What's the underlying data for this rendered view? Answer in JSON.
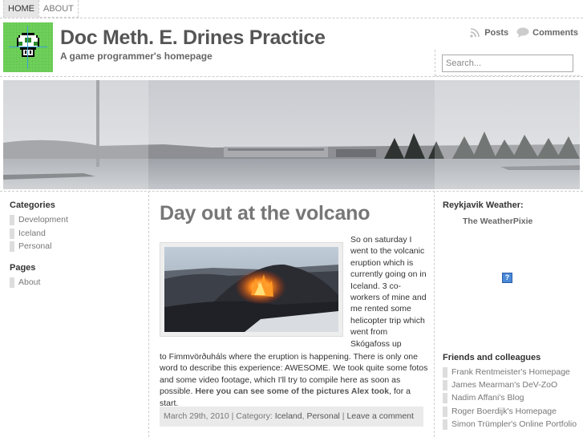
{
  "nav": {
    "items": [
      {
        "label": "HOME",
        "active": true
      },
      {
        "label": "ABOUT",
        "active": false
      }
    ]
  },
  "header": {
    "logo_icon": "mushroom-icon",
    "title": "Doc Meth. E. Drines Practice",
    "tagline": "A game programmer's homepage",
    "posts_label": "Posts",
    "comments_label": "Comments",
    "search_placeholder": "Search..."
  },
  "sidebar_left": {
    "categories_heading": "Categories",
    "categories": [
      "Development",
      "Iceland",
      "Personal"
    ],
    "pages_heading": "Pages",
    "pages": [
      "About"
    ]
  },
  "post": {
    "title": "Day out at the volcano",
    "text_beside_image": "So on saturday I went to the volcanic eruption which is currently going on in Iceland. 3 co-workers of mine and me rented some helicopter trip which went from Skógafoss up",
    "text_below_image": "to Fimmvörðuháls where the eruption is happening. There is only one word to describe this experience: AWESOME. We took quite some fotos and some video footage, which I'll try to compile here as soon as possible.",
    "link_text": "Here you can see some of the pictures Alex took",
    "link_tail": ", for a start.",
    "meta": {
      "date": "March 29th, 2010",
      "separator": " | ",
      "category_label": "Category: ",
      "category_1": "Iceland",
      "category_sep": ", ",
      "category_2": "Personal",
      "comment_link": "Leave a comment"
    }
  },
  "sidebar_right": {
    "weather_heading": "Reykjavik Weather:",
    "weather_link": "The WeatherPixie",
    "weather_image_alt": "?",
    "friends_heading": "Friends and colleagues",
    "friends": [
      "Frank Rentmeister's Homepage",
      "James Mearman's DeV-ZoO",
      "Nadim Affani's Blog",
      "Roger Boerdijk's Homepage",
      "Simon Trümpler's Online Portfolio"
    ]
  },
  "colors": {
    "logo_bg": "#6fd05a",
    "accent_gray": "#555555",
    "meta_bg": "#eaeaea"
  }
}
